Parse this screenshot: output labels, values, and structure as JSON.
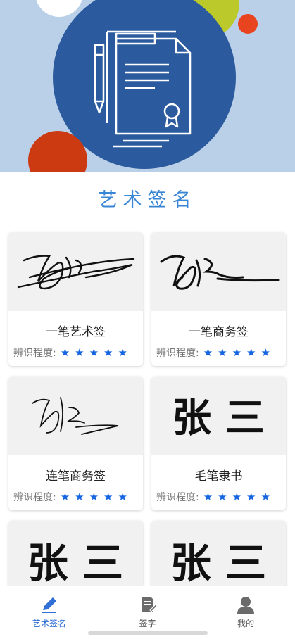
{
  "title": "艺术签名",
  "rating_label": "辨识程度:",
  "stars": "★★★★★",
  "cards": [
    {
      "name": "一笔艺术签"
    },
    {
      "name": "一笔商务签"
    },
    {
      "name": "连笔商务签"
    },
    {
      "name": "毛笔隶书",
      "preview_text": "张 三"
    },
    {
      "preview_text": "张 三"
    },
    {
      "preview_text": "张 三"
    }
  ],
  "tabs": [
    {
      "label": "艺术签名",
      "icon": "pencil-icon",
      "active": true
    },
    {
      "label": "签字",
      "icon": "document-sign-icon",
      "active": false
    },
    {
      "label": "我的",
      "icon": "user-icon",
      "active": false
    }
  ],
  "colors": {
    "accent": "#2f6fd6",
    "star": "#1565e0",
    "hero_bg": "#b9d0e8",
    "hero_circle": "#2b5b9e"
  }
}
